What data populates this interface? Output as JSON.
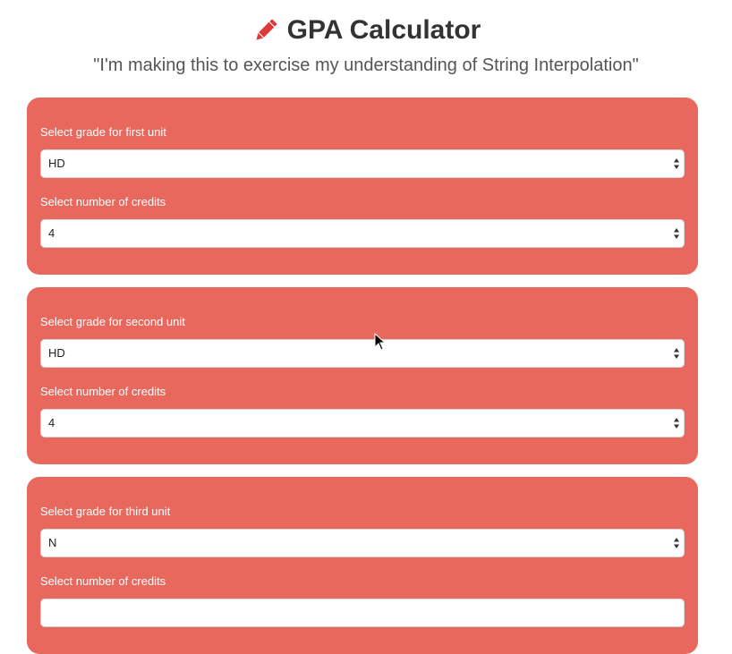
{
  "header": {
    "title": "GPA Calculator",
    "subtitle": "\"I'm making this to exercise my understanding of String Interpolation\"",
    "icon": "pencil-icon"
  },
  "colors": {
    "panel": "#e9685d",
    "title": "#333333",
    "pencil": "#dc3a3a"
  },
  "units": [
    {
      "grade_label": "Select grade for first unit",
      "grade_value": "HD",
      "credits_label": "Select number of credits",
      "credits_value": "4"
    },
    {
      "grade_label": "Select grade for second unit",
      "grade_value": "HD",
      "credits_label": "Select number of credits",
      "credits_value": "4"
    },
    {
      "grade_label": "Select grade for third unit",
      "grade_value": "N",
      "credits_label": "Select number of credits",
      "credits_value": ""
    }
  ]
}
